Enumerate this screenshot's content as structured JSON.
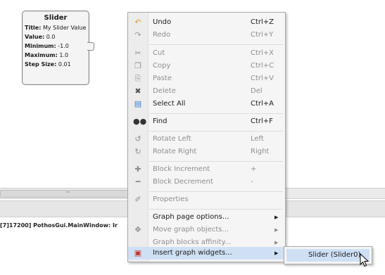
{
  "block": {
    "title": "Slider",
    "rows": [
      {
        "key": "Title:",
        "value": "My Slider Value"
      },
      {
        "key": "Value:",
        "value": "0.0"
      },
      {
        "key": "Minimum:",
        "value": "-1.0"
      },
      {
        "key": "Maximum:",
        "value": "1.0"
      },
      {
        "key": "Step Size:",
        "value": "0.01"
      }
    ]
  },
  "scroll": {
    "grip_label": "'''"
  },
  "log": {
    "text": "[7]17200] PothosGui.MainWindow: Ir"
  },
  "menu": {
    "undo": {
      "label": "Undo",
      "shortcut": "Ctrl+Z",
      "icon": "undo-icon"
    },
    "redo": {
      "label": "Redo",
      "shortcut": "Ctrl+Y",
      "icon": "redo-icon"
    },
    "cut": {
      "label": "Cut",
      "shortcut": "Ctrl+X",
      "icon": "cut-icon"
    },
    "copy": {
      "label": "Copy",
      "shortcut": "Ctrl+C",
      "icon": "copy-icon"
    },
    "paste": {
      "label": "Paste",
      "shortcut": "Ctrl+V",
      "icon": "paste-icon"
    },
    "delete": {
      "label": "Delete",
      "shortcut": "Del",
      "icon": "delete-icon"
    },
    "select_all": {
      "label": "Select All",
      "shortcut": "Ctrl+A",
      "icon": "select-all-icon"
    },
    "find": {
      "label": "Find",
      "shortcut": "Ctrl+F",
      "icon": "binoculars-icon"
    },
    "rotate_left": {
      "label": "Rotate Left",
      "shortcut": "Left",
      "icon": "rotate-left-icon"
    },
    "rotate_right": {
      "label": "Rotate Right",
      "shortcut": "Right",
      "icon": "rotate-right-icon"
    },
    "block_increment": {
      "label": "Block Increment",
      "shortcut": "+",
      "icon": "plus-icon"
    },
    "block_decrement": {
      "label": "Block Decrement",
      "shortcut": "-",
      "icon": "minus-icon"
    },
    "properties": {
      "label": "Properties",
      "icon": "properties-icon"
    },
    "graph_page_options": {
      "label": "Graph page options..."
    },
    "move_graph_objects": {
      "label": "Move graph objects...",
      "icon": "move-icon"
    },
    "graph_blocks_affinity": {
      "label": "Graph blocks affinity..."
    },
    "insert_graph_widgets": {
      "label": "Insert graph widgets...",
      "icon": "widgets-icon"
    }
  },
  "submenu": {
    "items": [
      {
        "label": "Slider (Slider0)"
      }
    ]
  },
  "colors": {
    "highlight": "#cfe0f5",
    "disabled_text": "#8e8e8e",
    "menu_bg": "#f5f5f5"
  }
}
